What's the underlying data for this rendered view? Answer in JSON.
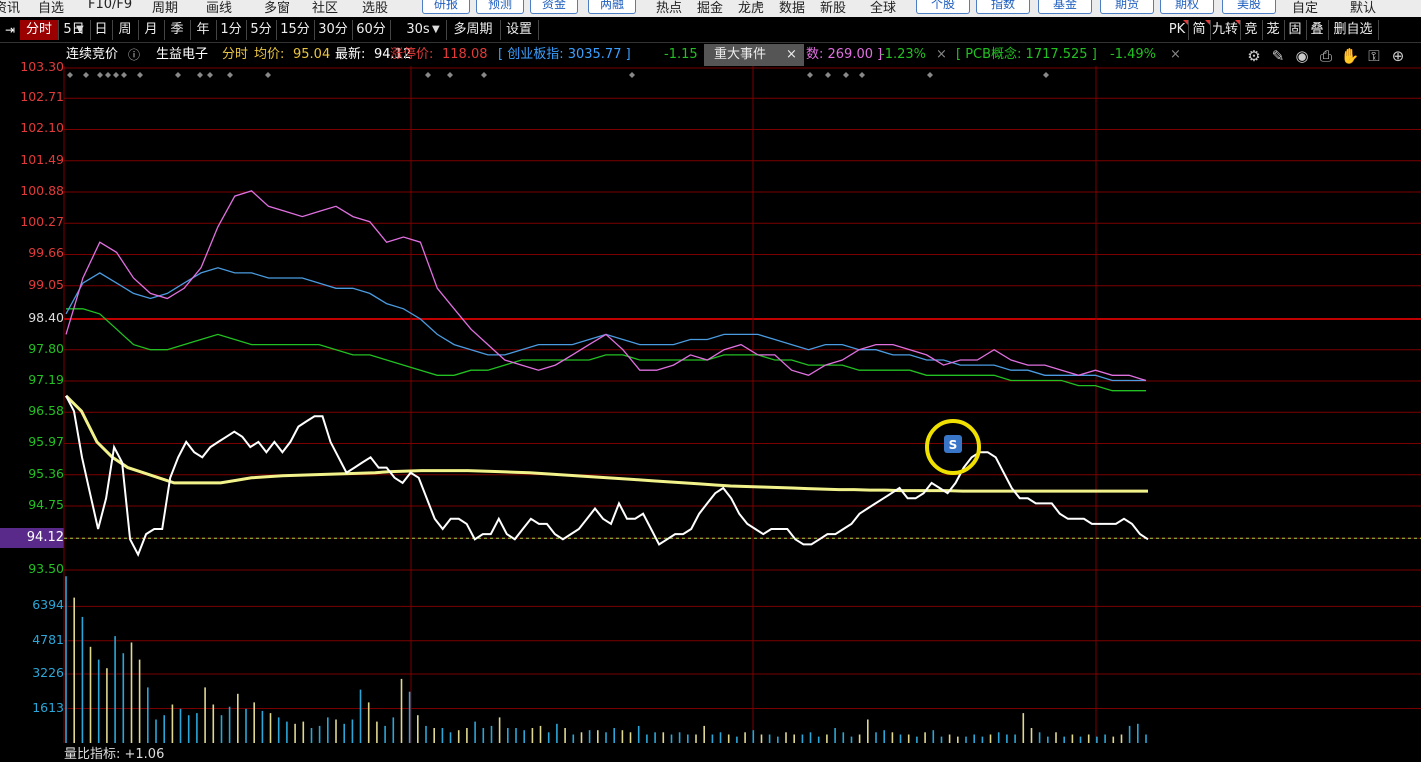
{
  "top_nav": {
    "items": [
      "资讯",
      "自选",
      "F10/F9",
      "周期",
      "画线",
      "多窗",
      "社区",
      "选股"
    ],
    "blue_buttons_1": [
      "研报",
      "预测",
      "资金",
      "两融"
    ],
    "plain_items": [
      "热点",
      "掘金",
      "龙虎",
      "数据",
      "新股",
      "全球"
    ],
    "blue_buttons_2": [
      "个股",
      "指数",
      "基金",
      "期货",
      "期权",
      "美股"
    ],
    "tail_items": [
      "自定",
      "默认"
    ]
  },
  "toolbar": {
    "collapse_icon": "panel-collapse-icon",
    "tabs": [
      "分时",
      "5日",
      "日",
      "周",
      "月",
      "季",
      "年",
      "1分",
      "5分",
      "15分",
      "30分",
      "60分",
      "30s",
      "多周期",
      "设置"
    ],
    "active_tab": "分时",
    "right_buttons": [
      "PK",
      "简",
      "九转",
      "竞",
      "茏",
      "固",
      "叠",
      "删自选"
    ]
  },
  "info_bar": {
    "auction_label": "连续竞价",
    "stock_name": "生益电子",
    "mode": "分时",
    "avg_label": "均价:",
    "avg_value": "95.04",
    "last_label": "最新:",
    "last_value": "94.12",
    "limit_label": "涨停价:",
    "limit_value": "118.08",
    "idx1": "[ 创业板指: 3035.77 ]",
    "idx1_chg": "-1.15",
    "idx2_tail": "数: 269.00 ]",
    "idx2_chg": "-1.23%",
    "idx3": "[ PCB概念: 1717.525 ]",
    "idx3_chg": "-1.49%",
    "close_mark": "×",
    "event_tab": "重大事件",
    "event_close": "×"
  },
  "right_icons": [
    "settings-icon",
    "pen-icon",
    "eye-icon",
    "print-icon",
    "hand-icon",
    "lock-icon",
    "plus-icon"
  ],
  "colors": {
    "up": "#e23a3a",
    "price_line": "#ffffff",
    "avg_line": "#f2f28a",
    "index_pink": "#e070e0",
    "index_blue": "#4a9be0",
    "index_green": "#22c022",
    "volume_bar": "#2aa7d8",
    "volume_bar_alt": "#e0d890",
    "grid": "#7a0000"
  },
  "chart_data": {
    "type": "line",
    "ylim": [
      93.5,
      103.3
    ],
    "y_ticks": [
      "103.30",
      "102.71",
      "102.10",
      "101.49",
      "100.88",
      "100.27",
      "99.66",
      "99.05",
      "98.40",
      "97.80",
      "97.19",
      "96.58",
      "95.97",
      "95.36",
      "94.75",
      "94.12",
      "93.50"
    ],
    "prev_close": 98.4,
    "current_price": "94.12",
    "price_series": [
      96.9,
      96.6,
      95.7,
      95.0,
      94.3,
      94.9,
      95.9,
      95.6,
      94.1,
      93.8,
      94.2,
      94.3,
      94.3,
      95.3,
      95.7,
      96.0,
      95.8,
      95.7,
      95.9,
      96.0,
      96.1,
      96.2,
      96.1,
      95.9,
      96.0,
      95.8,
      96.0,
      95.8,
      96.0,
      96.3,
      96.4,
      96.5,
      96.5,
      96.0,
      95.7,
      95.4,
      95.5,
      95.6,
      95.7,
      95.5,
      95.5,
      95.3,
      95.2,
      95.4,
      95.3,
      94.9,
      94.5,
      94.3,
      94.5,
      94.5,
      94.4,
      94.1,
      94.2,
      94.2,
      94.5,
      94.2,
      94.1,
      94.3,
      94.5,
      94.4,
      94.4,
      94.2,
      94.1,
      94.2,
      94.3,
      94.5,
      94.7,
      94.5,
      94.4,
      94.8,
      94.5,
      94.5,
      94.6,
      94.3,
      94.0,
      94.1,
      94.2,
      94.2,
      94.3,
      94.6,
      94.8,
      95.0,
      95.1,
      94.9,
      94.6,
      94.4,
      94.3,
      94.2,
      94.3,
      94.3,
      94.3,
      94.1,
      94.0,
      94.0,
      94.1,
      94.2,
      94.2,
      94.3,
      94.4,
      94.6,
      94.7,
      94.8,
      94.9,
      95.0,
      95.1,
      94.9,
      94.9,
      95.0,
      95.2,
      95.1,
      95.0,
      95.2,
      95.5,
      95.7,
      95.8,
      95.8,
      95.7,
      95.4,
      95.1,
      94.9,
      94.9,
      94.8,
      94.8,
      94.8,
      94.6,
      94.5,
      94.5,
      94.5,
      94.4,
      94.4,
      94.4,
      94.4,
      94.5,
      94.4,
      94.2,
      94.1
    ],
    "avg_series": [
      96.9,
      96.6,
      96.0,
      95.7,
      95.5,
      95.4,
      95.3,
      95.2,
      95.2,
      95.2,
      95.2,
      95.25,
      95.3,
      95.32,
      95.34,
      95.35,
      95.36,
      95.37,
      95.38,
      95.39,
      95.4,
      95.42,
      95.43,
      95.44,
      95.44,
      95.44,
      95.44,
      95.43,
      95.42,
      95.41,
      95.4,
      95.38,
      95.36,
      95.34,
      95.32,
      95.3,
      95.28,
      95.26,
      95.24,
      95.22,
      95.2,
      95.18,
      95.16,
      95.14,
      95.13,
      95.12,
      95.11,
      95.1,
      95.09,
      95.08,
      95.07,
      95.07,
      95.06,
      95.06,
      95.05,
      95.05,
      95.05,
      95.05,
      95.04,
      95.04,
      95.04,
      95.04,
      95.04,
      95.04,
      95.04,
      95.04,
      95.04,
      95.04,
      95.04,
      95.04,
      95.04
    ],
    "index_pink": [
      98.1,
      99.2,
      99.9,
      99.7,
      99.2,
      98.9,
      98.8,
      99.0,
      99.4,
      100.2,
      100.8,
      100.9,
      100.6,
      100.5,
      100.4,
      100.5,
      100.6,
      100.4,
      100.3,
      99.9,
      100.0,
      99.9,
      99.0,
      98.6,
      98.2,
      97.9,
      97.6,
      97.5,
      97.4,
      97.5,
      97.7,
      97.9,
      98.1,
      97.8,
      97.4,
      97.4,
      97.5,
      97.7,
      97.6,
      97.8,
      97.9,
      97.7,
      97.7,
      97.4,
      97.3,
      97.5,
      97.6,
      97.8,
      97.9,
      97.9,
      97.8,
      97.7,
      97.5,
      97.6,
      97.6,
      97.8,
      97.6,
      97.5,
      97.5,
      97.4,
      97.3,
      97.4,
      97.3,
      97.3,
      97.2
    ],
    "index_blue": [
      98.5,
      99.1,
      99.3,
      99.1,
      98.9,
      98.8,
      98.9,
      99.1,
      99.3,
      99.4,
      99.3,
      99.3,
      99.2,
      99.2,
      99.2,
      99.1,
      99.0,
      99.0,
      98.9,
      98.7,
      98.6,
      98.4,
      98.1,
      97.9,
      97.8,
      97.7,
      97.7,
      97.8,
      97.9,
      97.9,
      97.9,
      98.0,
      98.1,
      98.0,
      97.9,
      97.9,
      97.9,
      98.0,
      98.0,
      98.1,
      98.1,
      98.1,
      98.0,
      97.9,
      97.8,
      97.9,
      97.9,
      97.8,
      97.8,
      97.7,
      97.7,
      97.6,
      97.6,
      97.5,
      97.5,
      97.5,
      97.4,
      97.4,
      97.3,
      97.3,
      97.3,
      97.3,
      97.2,
      97.2,
      97.2
    ],
    "index_green": [
      98.6,
      98.6,
      98.5,
      98.2,
      97.9,
      97.8,
      97.8,
      97.9,
      98.0,
      98.1,
      98.0,
      97.9,
      97.9,
      97.9,
      97.9,
      97.9,
      97.8,
      97.7,
      97.7,
      97.6,
      97.5,
      97.4,
      97.3,
      97.3,
      97.4,
      97.4,
      97.5,
      97.6,
      97.6,
      97.6,
      97.6,
      97.6,
      97.7,
      97.7,
      97.6,
      97.6,
      97.6,
      97.6,
      97.6,
      97.7,
      97.7,
      97.7,
      97.6,
      97.6,
      97.5,
      97.5,
      97.5,
      97.4,
      97.4,
      97.4,
      97.4,
      97.3,
      97.3,
      97.3,
      97.3,
      97.3,
      97.2,
      97.2,
      97.2,
      97.2,
      97.1,
      97.1,
      97.0,
      97.0,
      97.0
    ],
    "volume_ticks": [
      "6394",
      "4781",
      "3226",
      "1613"
    ],
    "volume_max": 8000,
    "volumes": [
      7800,
      6800,
      5900,
      4500,
      3900,
      3500,
      5000,
      4200,
      4700,
      3900,
      2600,
      1100,
      1300,
      1800,
      1600,
      1300,
      1400,
      2600,
      1800,
      1300,
      1700,
      2300,
      1600,
      1900,
      1500,
      1400,
      1200,
      1000,
      900,
      1000,
      700,
      800,
      1200,
      1100,
      900,
      1100,
      2500,
      1900,
      1000,
      800,
      1200,
      3000,
      2400,
      1300,
      800,
      700,
      700,
      500,
      600,
      700,
      1000,
      700,
      800,
      1200,
      700,
      700,
      600,
      700,
      800,
      500,
      900,
      700,
      400,
      500,
      600,
      600,
      500,
      700,
      600,
      500,
      800,
      400,
      500,
      500,
      400,
      500,
      400,
      400,
      800,
      400,
      500,
      400,
      300,
      500,
      600,
      400,
      400,
      300,
      500,
      400,
      400,
      500,
      300,
      400,
      700,
      500,
      300,
      400,
      1100,
      500,
      600,
      500,
      400,
      400,
      300,
      500,
      600,
      300,
      400,
      300,
      300,
      400,
      300,
      400,
      500,
      400,
      400,
      1400,
      700,
      500,
      300,
      500,
      300,
      400,
      300,
      400,
      300,
      400,
      300,
      400,
      800,
      900,
      400
    ],
    "vol_ratio_label": "量比指标: +1.06"
  },
  "chart_marker": {
    "label": "S"
  }
}
